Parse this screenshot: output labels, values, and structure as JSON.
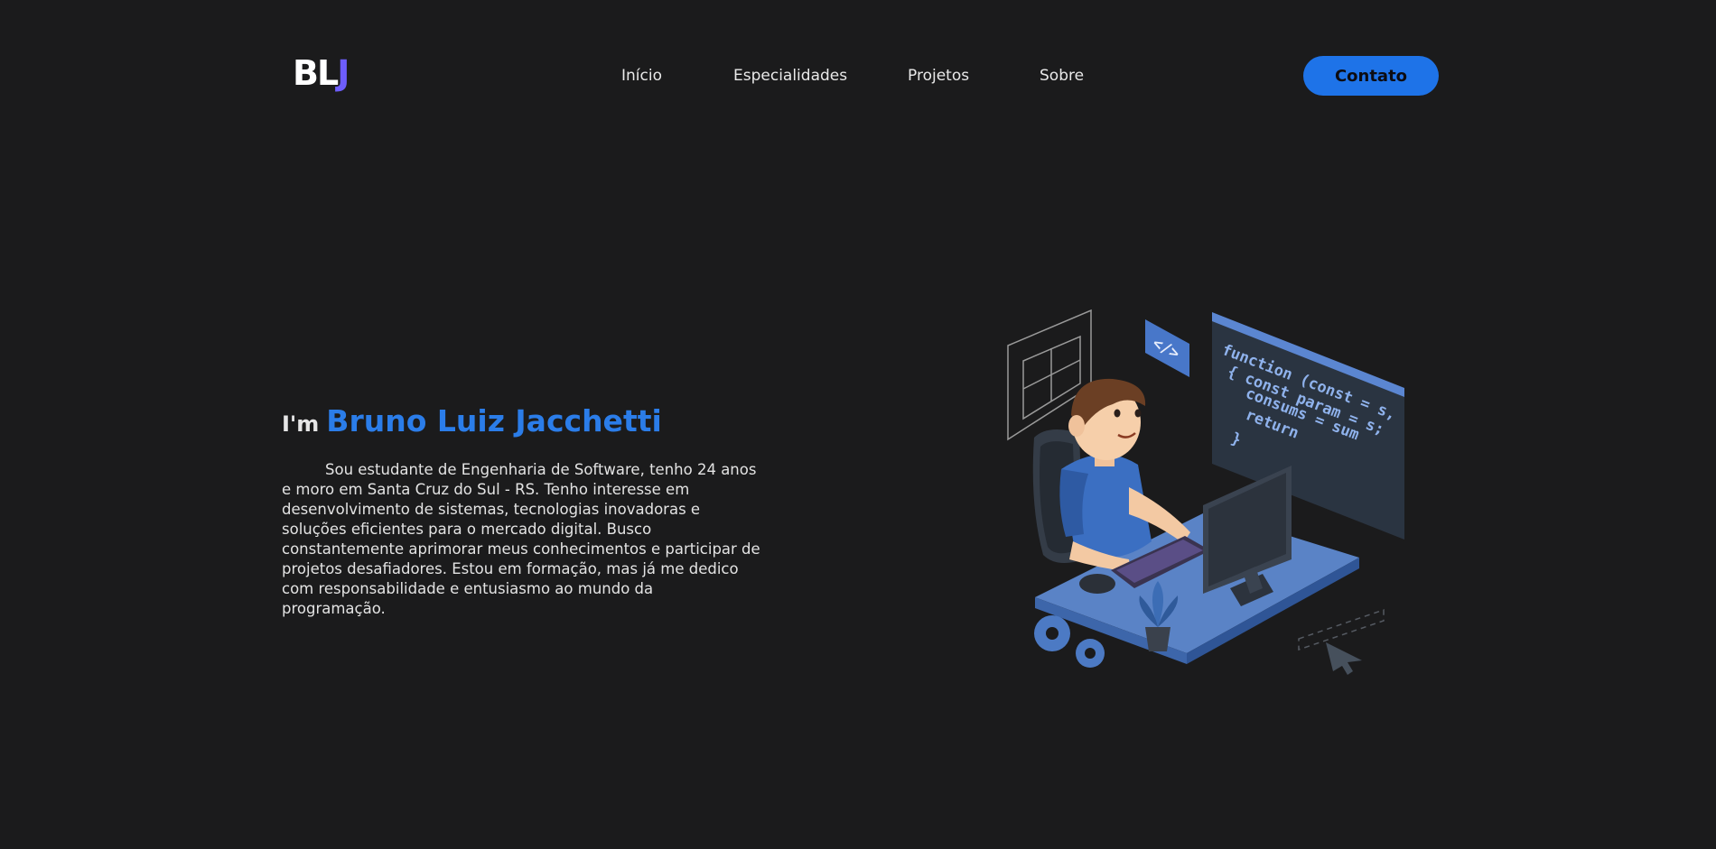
{
  "header": {
    "logo": {
      "part1": "BL",
      "part2": "J"
    },
    "nav": [
      {
        "label": "Início"
      },
      {
        "label": "Especialidades"
      },
      {
        "label": "Projetos"
      },
      {
        "label": "Sobre"
      }
    ],
    "contact_label": "Contato"
  },
  "hero": {
    "prefix": "I'm",
    "name": "Bruno Luiz Jacchetti",
    "bio": "Sou estudante de Engenharia de Software, tenho 24 anos e moro em Santa Cruz do Sul - RS. Tenho interesse em desenvolvimento de sistemas, tecnologias inovadoras e soluções eficientes para o mercado digital. Busco constantemente aprimorar meus conhecimentos e participar de projetos desafiadores. Estou em formação, mas já me dedico com responsabilidade e entusiasmo ao mundo da programação."
  },
  "illustration": {
    "code_badge": "</>",
    "code_lines": [
      "function (const = s,",
      "{  const param = s;",
      "   consums = sum",
      "   return",
      " }"
    ]
  },
  "colors": {
    "background": "#1b1b1c",
    "accent": "#1e73e8",
    "name": "#2b7de9",
    "logo_j": "#6d5dfc"
  }
}
